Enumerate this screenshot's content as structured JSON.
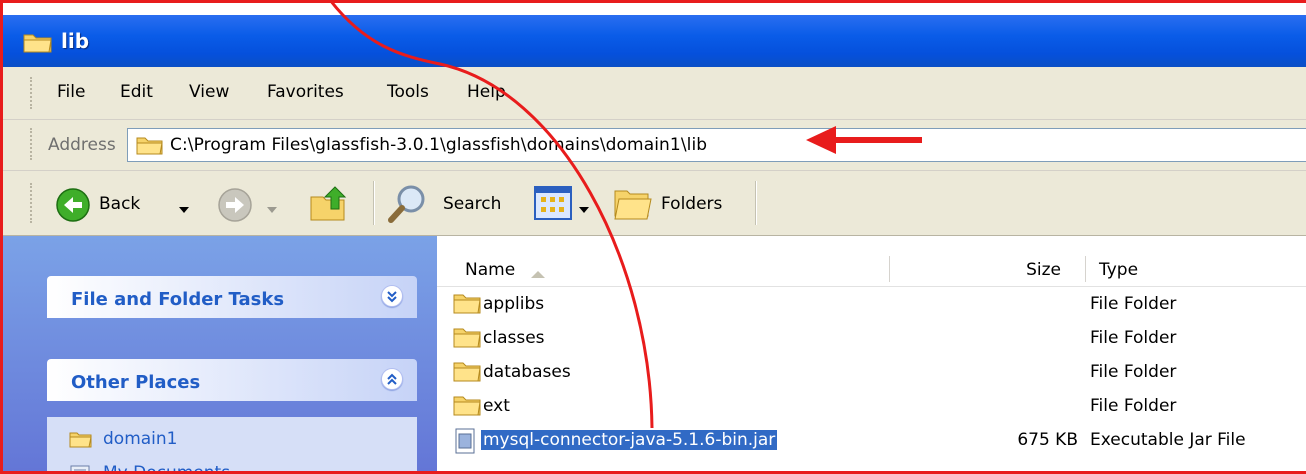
{
  "window": {
    "title": "lib"
  },
  "menu": {
    "items": [
      "File",
      "Edit",
      "View",
      "Favorites",
      "Tools",
      "Help"
    ]
  },
  "address": {
    "label": "Address",
    "path": "C:\\Program Files\\glassfish-3.0.1\\glassfish\\domains\\domain1\\lib"
  },
  "toolbar": {
    "back_label": "Back",
    "search_label": "Search",
    "folders_label": "Folders"
  },
  "taskpane": {
    "tasks_title": "File and Folder Tasks",
    "places_title": "Other Places",
    "places": [
      "domain1",
      "My Documents"
    ]
  },
  "columns": {
    "name": "Name",
    "size": "Size",
    "type": "Type"
  },
  "files": [
    {
      "name": "applibs",
      "size": "",
      "type": "File Folder",
      "kind": "folder"
    },
    {
      "name": "classes",
      "size": "",
      "type": "File Folder",
      "kind": "folder"
    },
    {
      "name": "databases",
      "size": "",
      "type": "File Folder",
      "kind": "folder"
    },
    {
      "name": "ext",
      "size": "",
      "type": "File Folder",
      "kind": "folder"
    },
    {
      "name": "mysql-connector-java-5.1.6-bin.jar",
      "size": "675 KB",
      "type": "Executable Jar File",
      "kind": "jar",
      "selected": true
    }
  ],
  "colors": {
    "annotation": "#e81c1c",
    "title_blue": "#0a5ce8",
    "link_blue": "#215dc6",
    "selection": "#316ac5"
  }
}
